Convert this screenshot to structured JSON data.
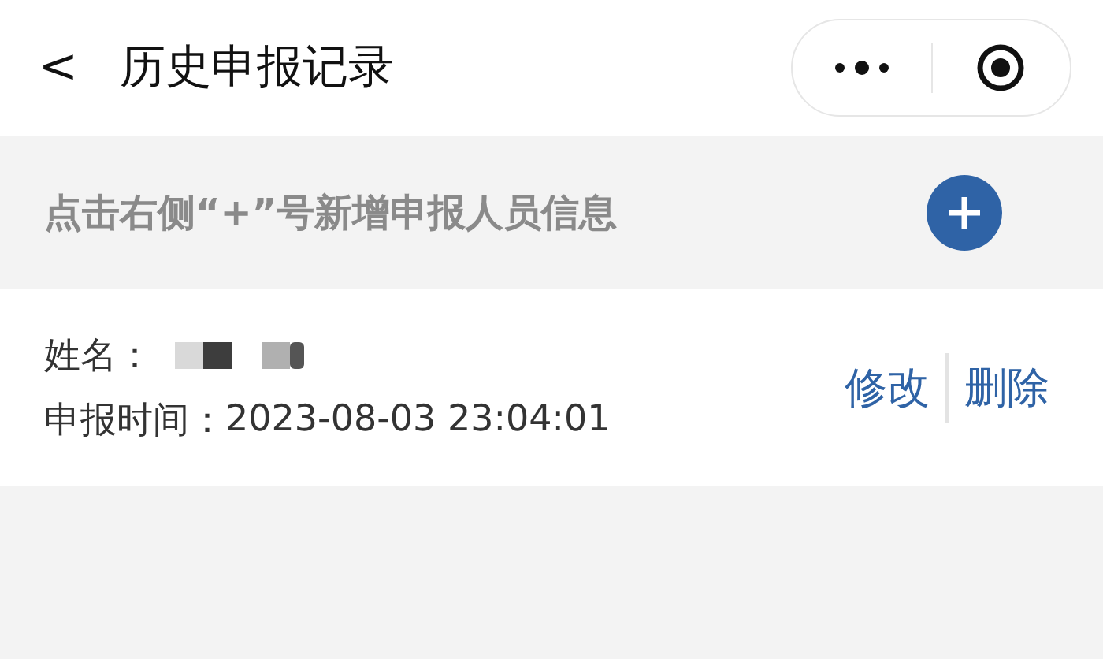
{
  "header": {
    "back": "<",
    "title": "历史申报记录"
  },
  "hint": {
    "text": "点击右侧“+”号新增申报人员信息"
  },
  "records": [
    {
      "name_label": "姓名：",
      "time_label": "申报时间：",
      "time": "2023-08-03 23:04:01",
      "actions": [
        "修改",
        "删除"
      ]
    }
  ]
}
